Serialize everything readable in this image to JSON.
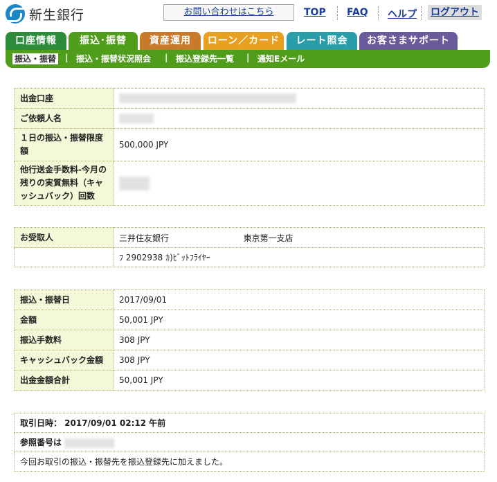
{
  "header": {
    "bank_name": "新生銀行",
    "contact_label": "お問い合わせはこちら",
    "top_label": "TOP",
    "faq_label": "FAQ",
    "help_label": "ヘルプ",
    "logout_label": "ログアウト"
  },
  "tabs": [
    {
      "label": "口座情報",
      "color": "#2c8c3c"
    },
    {
      "label": "振込･振替",
      "color": "#4f9d1a"
    },
    {
      "label": "資産運用",
      "color": "#c87a2a"
    },
    {
      "label": "ローン／カード",
      "color": "#e8a020"
    },
    {
      "label": "レート照会",
      "color": "#2a9ea8"
    },
    {
      "label": "お客さまサポート",
      "color": "#6a5a9a"
    }
  ],
  "subnav": [
    "振込・振替",
    "振込・振替状況照会",
    "振込登録先一覧",
    "通知Eメール"
  ],
  "account": {
    "withdraw_label": "出金口座",
    "requester_label": "ご依頼人名",
    "limit_label": "１日の振込・振替限度額",
    "limit_value": "500,000 JPY",
    "fee_label": "他行送金手数料-今月の残りの実質無料（キャッシュバック）回数"
  },
  "recipient": {
    "label": "お受取人",
    "bank": "三井住友銀行",
    "branch": "東京第一支店",
    "account": "ﾌ 2902938 ｶ)ﾋﾞｯﾄﾌﾗｲﾔｰ"
  },
  "transfer": {
    "date_label": "振込・振替日",
    "date_value": "2017/09/01",
    "amount_label": "金額",
    "amount_value": "50,001 JPY",
    "fee_label": "振込手数料",
    "fee_value": "308 JPY",
    "cashback_label": "キャッシュバック金額",
    "cashback_value": "308 JPY",
    "total_label": "出金金額合計",
    "total_value": "50,001 JPY"
  },
  "footer": {
    "datetime": "取引日時： 2017/09/01 02:12 午前",
    "ref_label": "参照番号は",
    "message": "今回お取引の振込・振替先を振込登録先に加えました。"
  }
}
